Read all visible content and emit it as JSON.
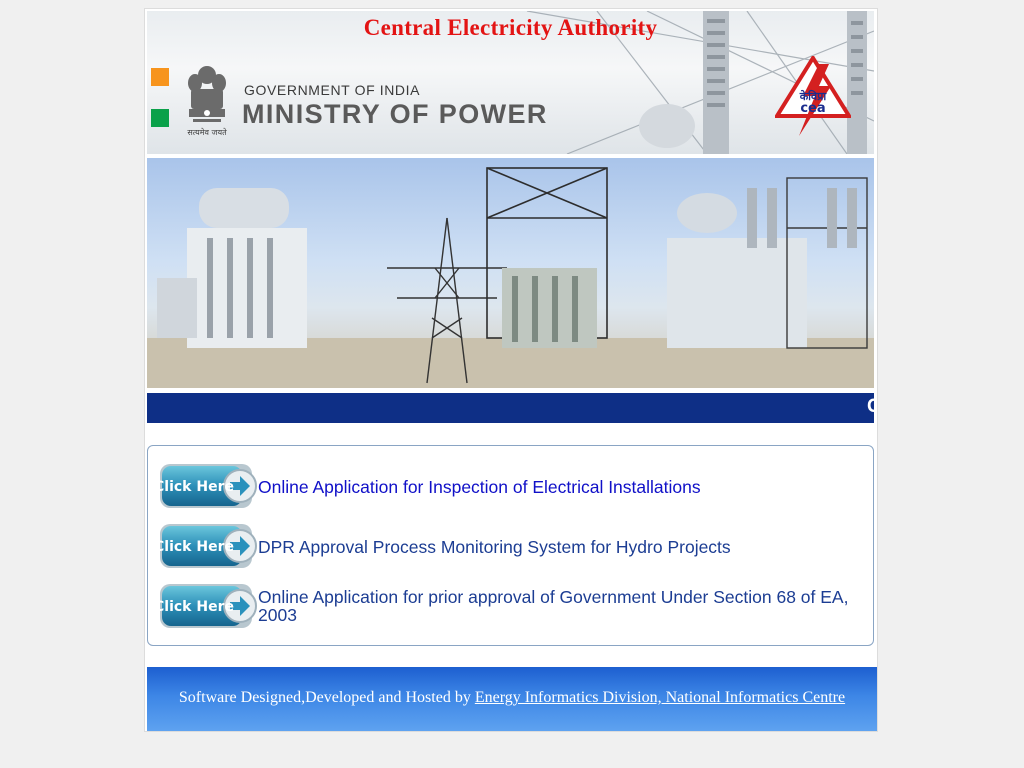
{
  "header": {
    "title": "Central Electricity Authority",
    "gov_line": "GOVERNMENT OF INDIA",
    "ministry_line": "MINISTRY OF POWER",
    "emblem_motto": "सत्यमेव जयते",
    "cea_logo_hindi": "केविप्रा",
    "cea_logo_text": "cea"
  },
  "marquee": {
    "visible_text": "C"
  },
  "links": [
    {
      "button_label": "Click Here",
      "text": "Online Application for Inspection of Electrical Installations"
    },
    {
      "button_label": "Click Here",
      "text": "DPR Approval Process Monitoring System for Hydro Projects"
    },
    {
      "button_label": "Click Here",
      "text": "Online Application for prior approval of Government Under Section 68 of EA, 2003"
    }
  ],
  "footer": {
    "prefix": "Software Designed,Developed and Hosted by ",
    "link_text": "Energy Informatics Division, National Informatics Centre"
  },
  "colors": {
    "title": "#e31414",
    "marquee_bg": "#0e2f86",
    "footer_bg": "#3d86e6",
    "square_orange": "#f7941d",
    "square_green": "#0aa14a"
  }
}
